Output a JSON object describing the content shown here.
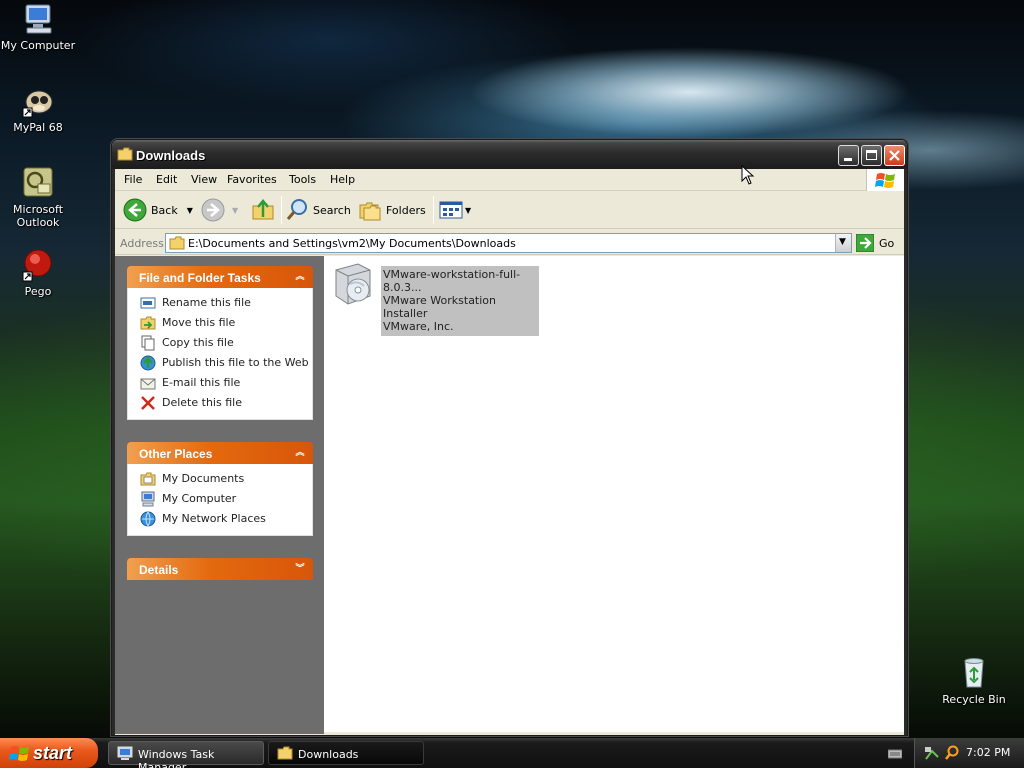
{
  "desktop": {
    "icons": [
      {
        "label": "My Computer",
        "icon": "my-computer-icon"
      },
      {
        "label": "MyPal 68",
        "icon": "mypal-icon"
      },
      {
        "label": "Microsoft Outlook",
        "icon": "outlook-icon"
      },
      {
        "label": "Pego",
        "icon": "pego-icon"
      },
      {
        "label": "Recycle Bin",
        "icon": "recycle-bin-icon"
      }
    ]
  },
  "window": {
    "title": "Downloads",
    "menu": [
      "File",
      "Edit",
      "View",
      "Favorites",
      "Tools",
      "Help"
    ],
    "toolbar": {
      "back": "Back",
      "search": "Search",
      "folders": "Folders"
    },
    "address": {
      "label": "Address",
      "path": "E:\\Documents and Settings\\vm2\\My Documents\\Downloads",
      "go": "Go"
    },
    "tasks": {
      "file_folder": {
        "title": "File and Folder Tasks",
        "items": [
          "Rename this file",
          "Move this file",
          "Copy this file",
          "Publish this file to the Web",
          "E-mail this file",
          "Delete this file"
        ]
      },
      "other_places": {
        "title": "Other Places",
        "items": [
          "My Documents",
          "My Computer",
          "My Network Places"
        ]
      },
      "details": {
        "title": "Details"
      }
    },
    "file": {
      "name": "VMware-workstation-full-8.0.3...",
      "description": "VMware Workstation Installer",
      "company": "VMware, Inc."
    }
  },
  "taskbar": {
    "start": "start",
    "tasks": [
      "Windows Task Manager",
      "Downloads"
    ],
    "clock": "7:02 PM"
  },
  "colors": {
    "task_pane_bg": "#6d6d6d",
    "task_header": "#e3690e",
    "start_button": "#ea5a1e"
  }
}
